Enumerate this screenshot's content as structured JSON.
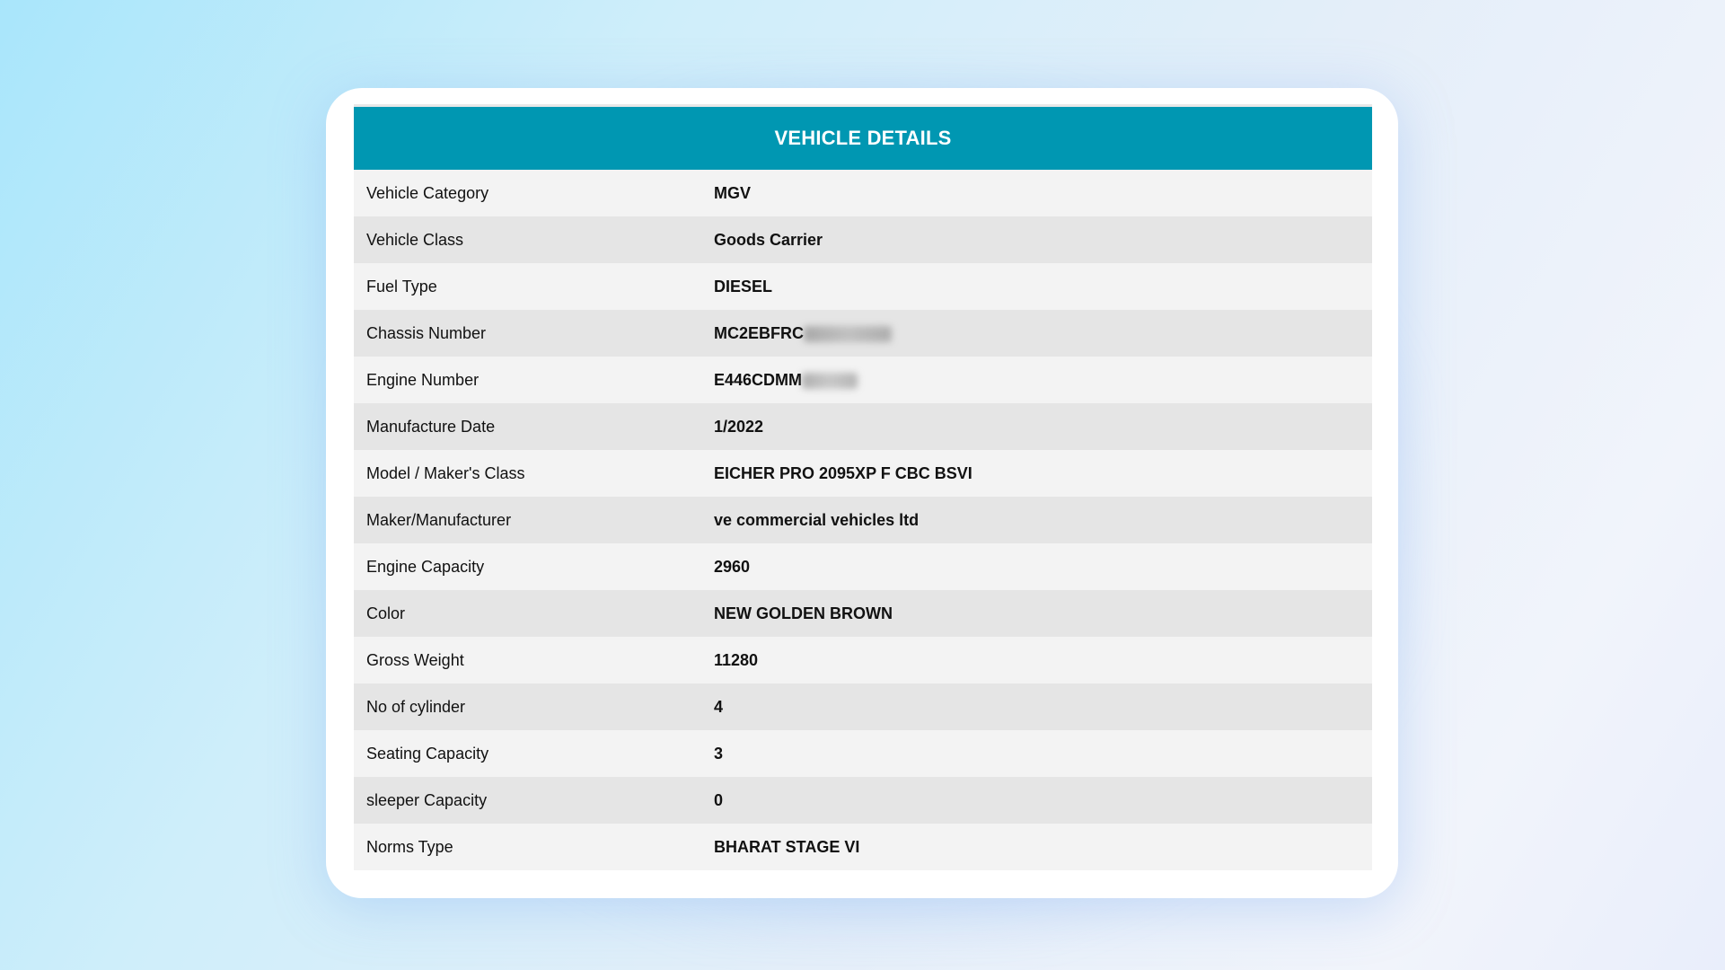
{
  "table": {
    "title": "VEHICLE DETAILS",
    "rows": [
      {
        "label": "Vehicle Category",
        "value": "MGV"
      },
      {
        "label": "Vehicle Class",
        "value": "Goods Carrier"
      },
      {
        "label": "Fuel Type",
        "value": "DIESEL"
      },
      {
        "label": "Chassis Number",
        "value": "MC2EBFRC",
        "masked": true
      },
      {
        "label": "Engine Number",
        "value": "E446CDMM",
        "masked": true
      },
      {
        "label": "Manufacture Date",
        "value": "1/2022"
      },
      {
        "label": "Model / Maker's Class",
        "value": "EICHER PRO 2095XP F CBC BSVI"
      },
      {
        "label": "Maker/Manufacturer",
        "value": "ve commercial vehicles ltd"
      },
      {
        "label": "Engine Capacity",
        "value": "2960"
      },
      {
        "label": "Color",
        "value": "NEW GOLDEN BROWN"
      },
      {
        "label": "Gross Weight",
        "value": "11280"
      },
      {
        "label": "No of cylinder",
        "value": "4"
      },
      {
        "label": "Seating Capacity",
        "value": "3"
      },
      {
        "label": "sleeper Capacity",
        "value": "0"
      },
      {
        "label": "Norms Type",
        "value": "BHARAT STAGE VI"
      }
    ]
  },
  "colors": {
    "header_bg": "#0097b2",
    "row_odd": "#e5e5e5",
    "row_even": "#f3f3f3"
  }
}
